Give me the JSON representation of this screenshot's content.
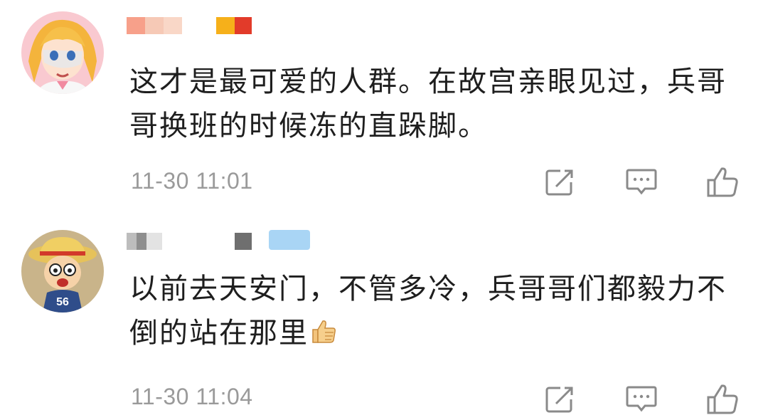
{
  "comments": [
    {
      "text": "这才是最可爱的人群。在故宫亲眼见过，兵哥哥换班的时候冻的直跺脚。",
      "time": "11-30 11:01",
      "avatar_icon": "anime-girl-avatar",
      "name_colors": [
        "#f7a08a",
        "#f6c9b6",
        "#f6b01a",
        "#e23b2a"
      ]
    },
    {
      "text": "以前去天安门，不管多冷，兵哥哥们都毅力不倒的站在那里",
      "emoji": "thumbs-up-emoji",
      "time": "11-30 11:04",
      "avatar_icon": "cartoon-boy-avatar",
      "name_colors": [
        "#bdbdbd",
        "#d9d9d9",
        "#6f6f6f",
        "#a9d5f5"
      ]
    }
  ],
  "actions": {
    "share_icon": "share-icon",
    "reply_icon": "comment-icon",
    "like_icon": "thumbs-up-icon",
    "icon_color": "#8a8a8a"
  }
}
